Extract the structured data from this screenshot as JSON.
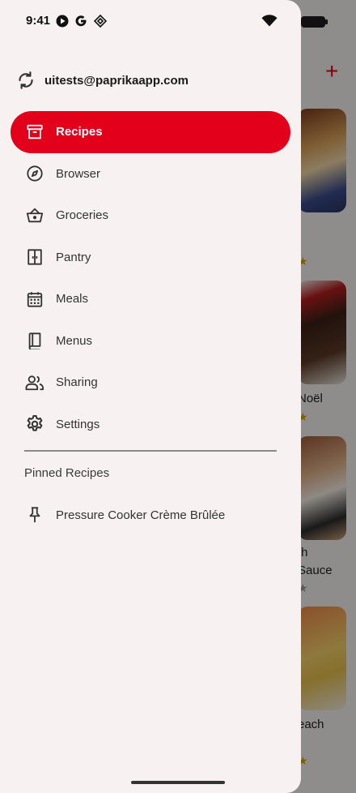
{
  "status_bar": {
    "time": "9:41"
  },
  "account": {
    "email": "uitests@paprikaapp.com",
    "icon": "sync-icon"
  },
  "nav": {
    "items": [
      {
        "label": "Recipes",
        "icon": "archive-box-icon",
        "active": true
      },
      {
        "label": "Browser",
        "icon": "compass-icon",
        "active": false
      },
      {
        "label": "Groceries",
        "icon": "basket-icon",
        "active": false
      },
      {
        "label": "Pantry",
        "icon": "pantry-door-icon",
        "active": false
      },
      {
        "label": "Meals",
        "icon": "calendar-icon",
        "active": false
      },
      {
        "label": "Menus",
        "icon": "book-icon",
        "active": false
      },
      {
        "label": "Sharing",
        "icon": "people-icon",
        "active": false
      },
      {
        "label": "Settings",
        "icon": "gear-icon",
        "active": false
      }
    ]
  },
  "pinned": {
    "header": "Pinned Recipes",
    "items": [
      {
        "label": "Pressure Cooker Crème Brûlée",
        "icon": "pin-icon"
      }
    ]
  },
  "background": {
    "add_label": "+",
    "card_texts": [
      "Noël",
      "th",
      "Sauce",
      "each"
    ]
  },
  "colors": {
    "accent": "#e2001a",
    "drawer_bg": "#f7f2f1"
  }
}
